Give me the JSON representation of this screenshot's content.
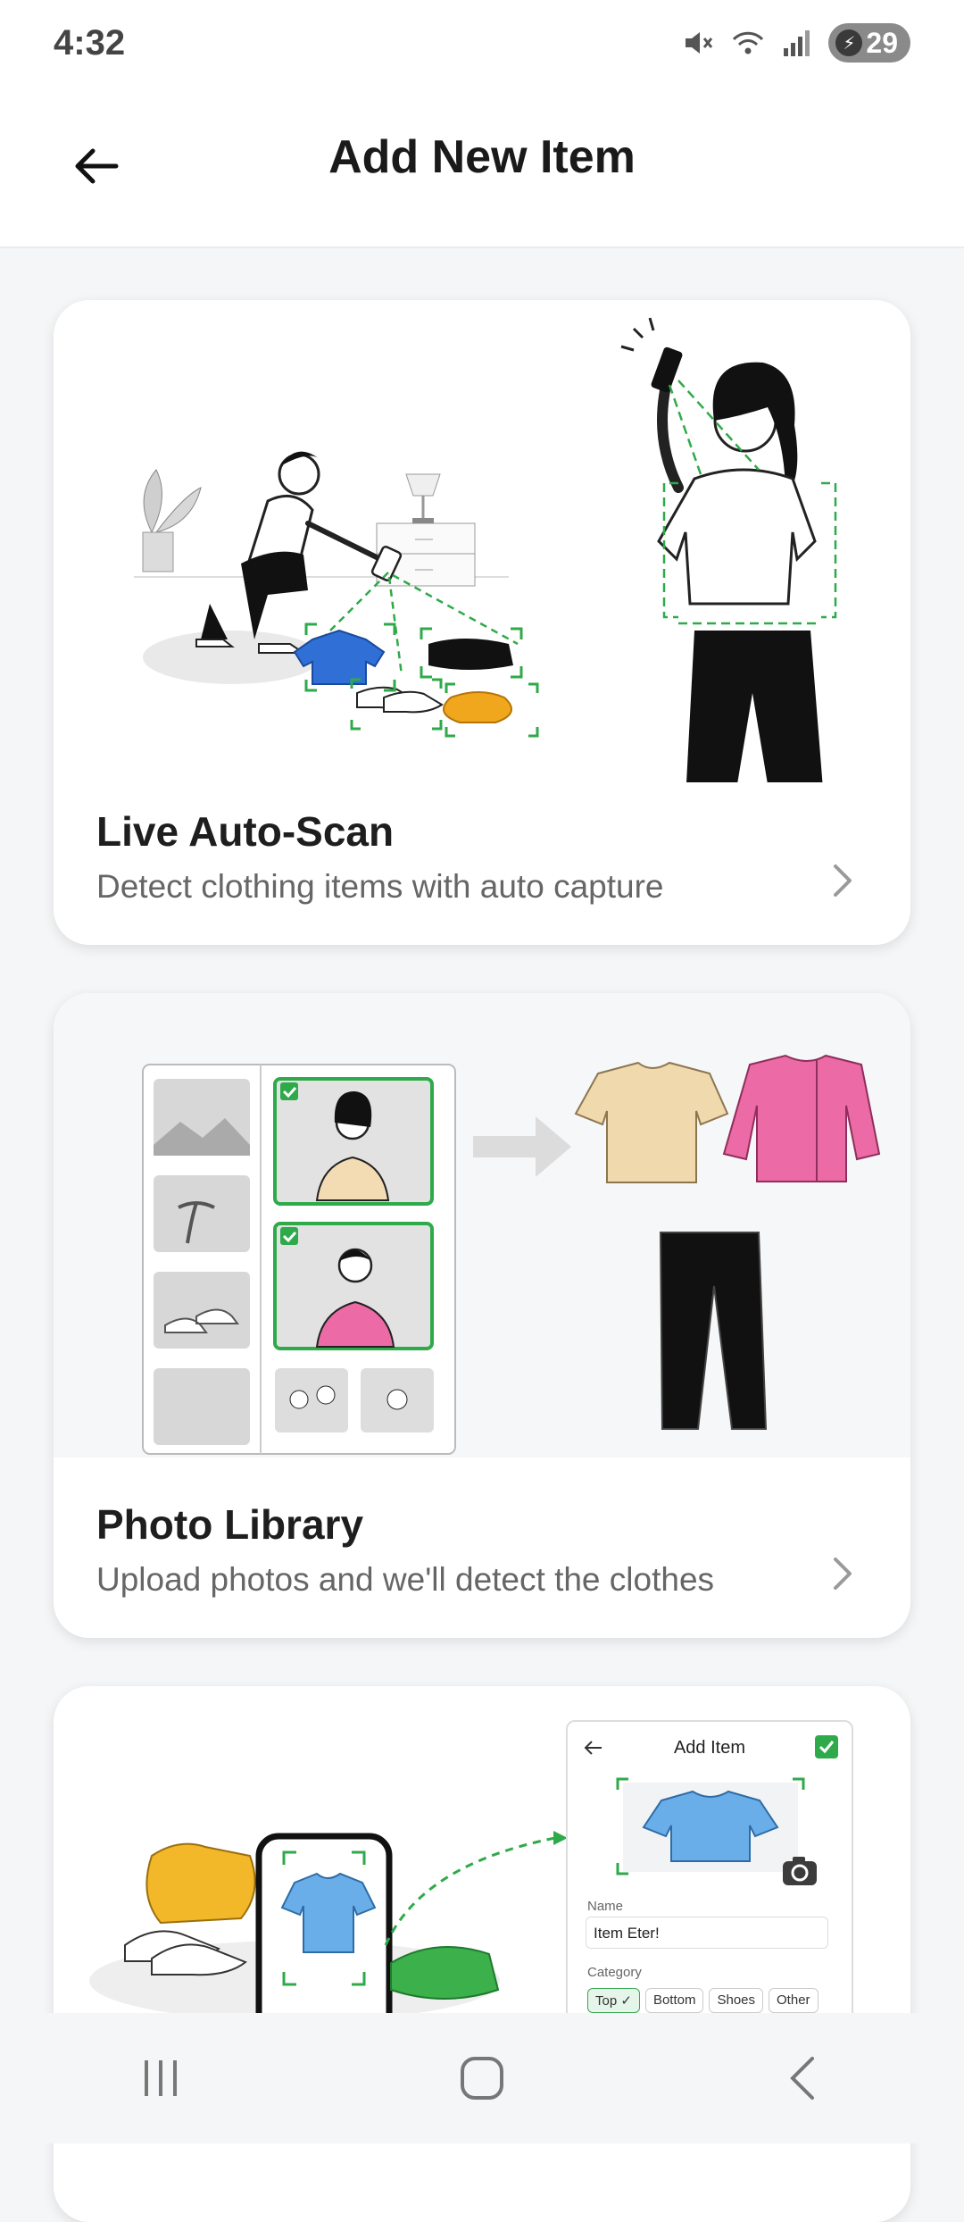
{
  "status_bar": {
    "time": "4:32",
    "battery": "29"
  },
  "header": {
    "title": "Add New Item"
  },
  "options": [
    {
      "title": "Live Auto-Scan",
      "subtitle": "Detect clothing items with auto capture"
    },
    {
      "title": "Photo Library",
      "subtitle": "Upload photos and we'll detect the clothes"
    },
    {
      "preview_form": {
        "title": "Add Item",
        "name_label": "Name",
        "name_value": "Item Eter!",
        "category_label": "Category",
        "categories": [
          "Top",
          "Bottom",
          "Shoes",
          "Other"
        ],
        "selected_category": "Top"
      }
    }
  ],
  "colors": {
    "accent_green": "#2faa4a",
    "background": "#f5f6f7",
    "card": "#ffffff"
  },
  "icons": [
    "back-arrow-icon",
    "mute-icon",
    "wifi-icon",
    "signal-icon",
    "battery-icon",
    "chevron-right-icon",
    "recent-apps-icon",
    "home-icon",
    "back-nav-icon"
  ]
}
